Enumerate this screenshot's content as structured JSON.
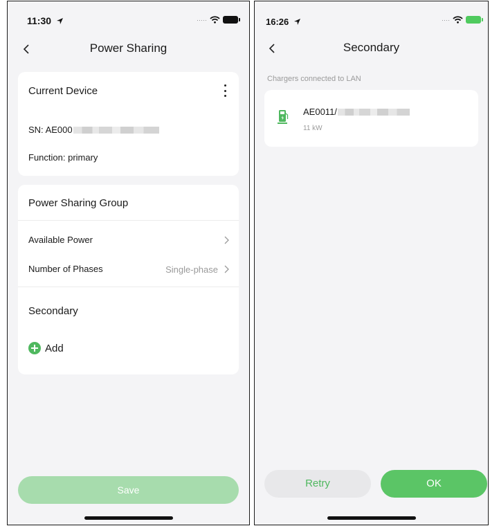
{
  "left_screen": {
    "status": {
      "time": "11:30"
    },
    "nav": {
      "title": "Power Sharing"
    },
    "current_device": {
      "heading": "Current Device",
      "sn": "SN: AE000",
      "function": "Function: primary"
    },
    "group": {
      "heading": "Power Sharing Group",
      "available_power": "Available Power",
      "phases_label": "Number of Phases",
      "phases_value": "Single-phase",
      "secondary_heading": "Secondary",
      "add_label": "Add"
    },
    "save_label": "Save"
  },
  "right_screen": {
    "status": {
      "time": "16:26"
    },
    "nav": {
      "title": "Secondary"
    },
    "section_caption": "Chargers connected to LAN",
    "charger": {
      "name": "AE0011/",
      "power": "11 kW"
    },
    "retry_label": "Retry",
    "ok_label": "OK"
  },
  "colors": {
    "accent_green": "#5bc566",
    "disabled_green": "#a7dcad",
    "background": "#f4f4f6"
  },
  "icons": [
    "location-arrow-icon",
    "wifi-icon",
    "battery-icon",
    "back-chevron-icon",
    "more-vert-icon",
    "chevron-right-icon",
    "plus-circle-icon",
    "ev-charger-icon"
  ]
}
